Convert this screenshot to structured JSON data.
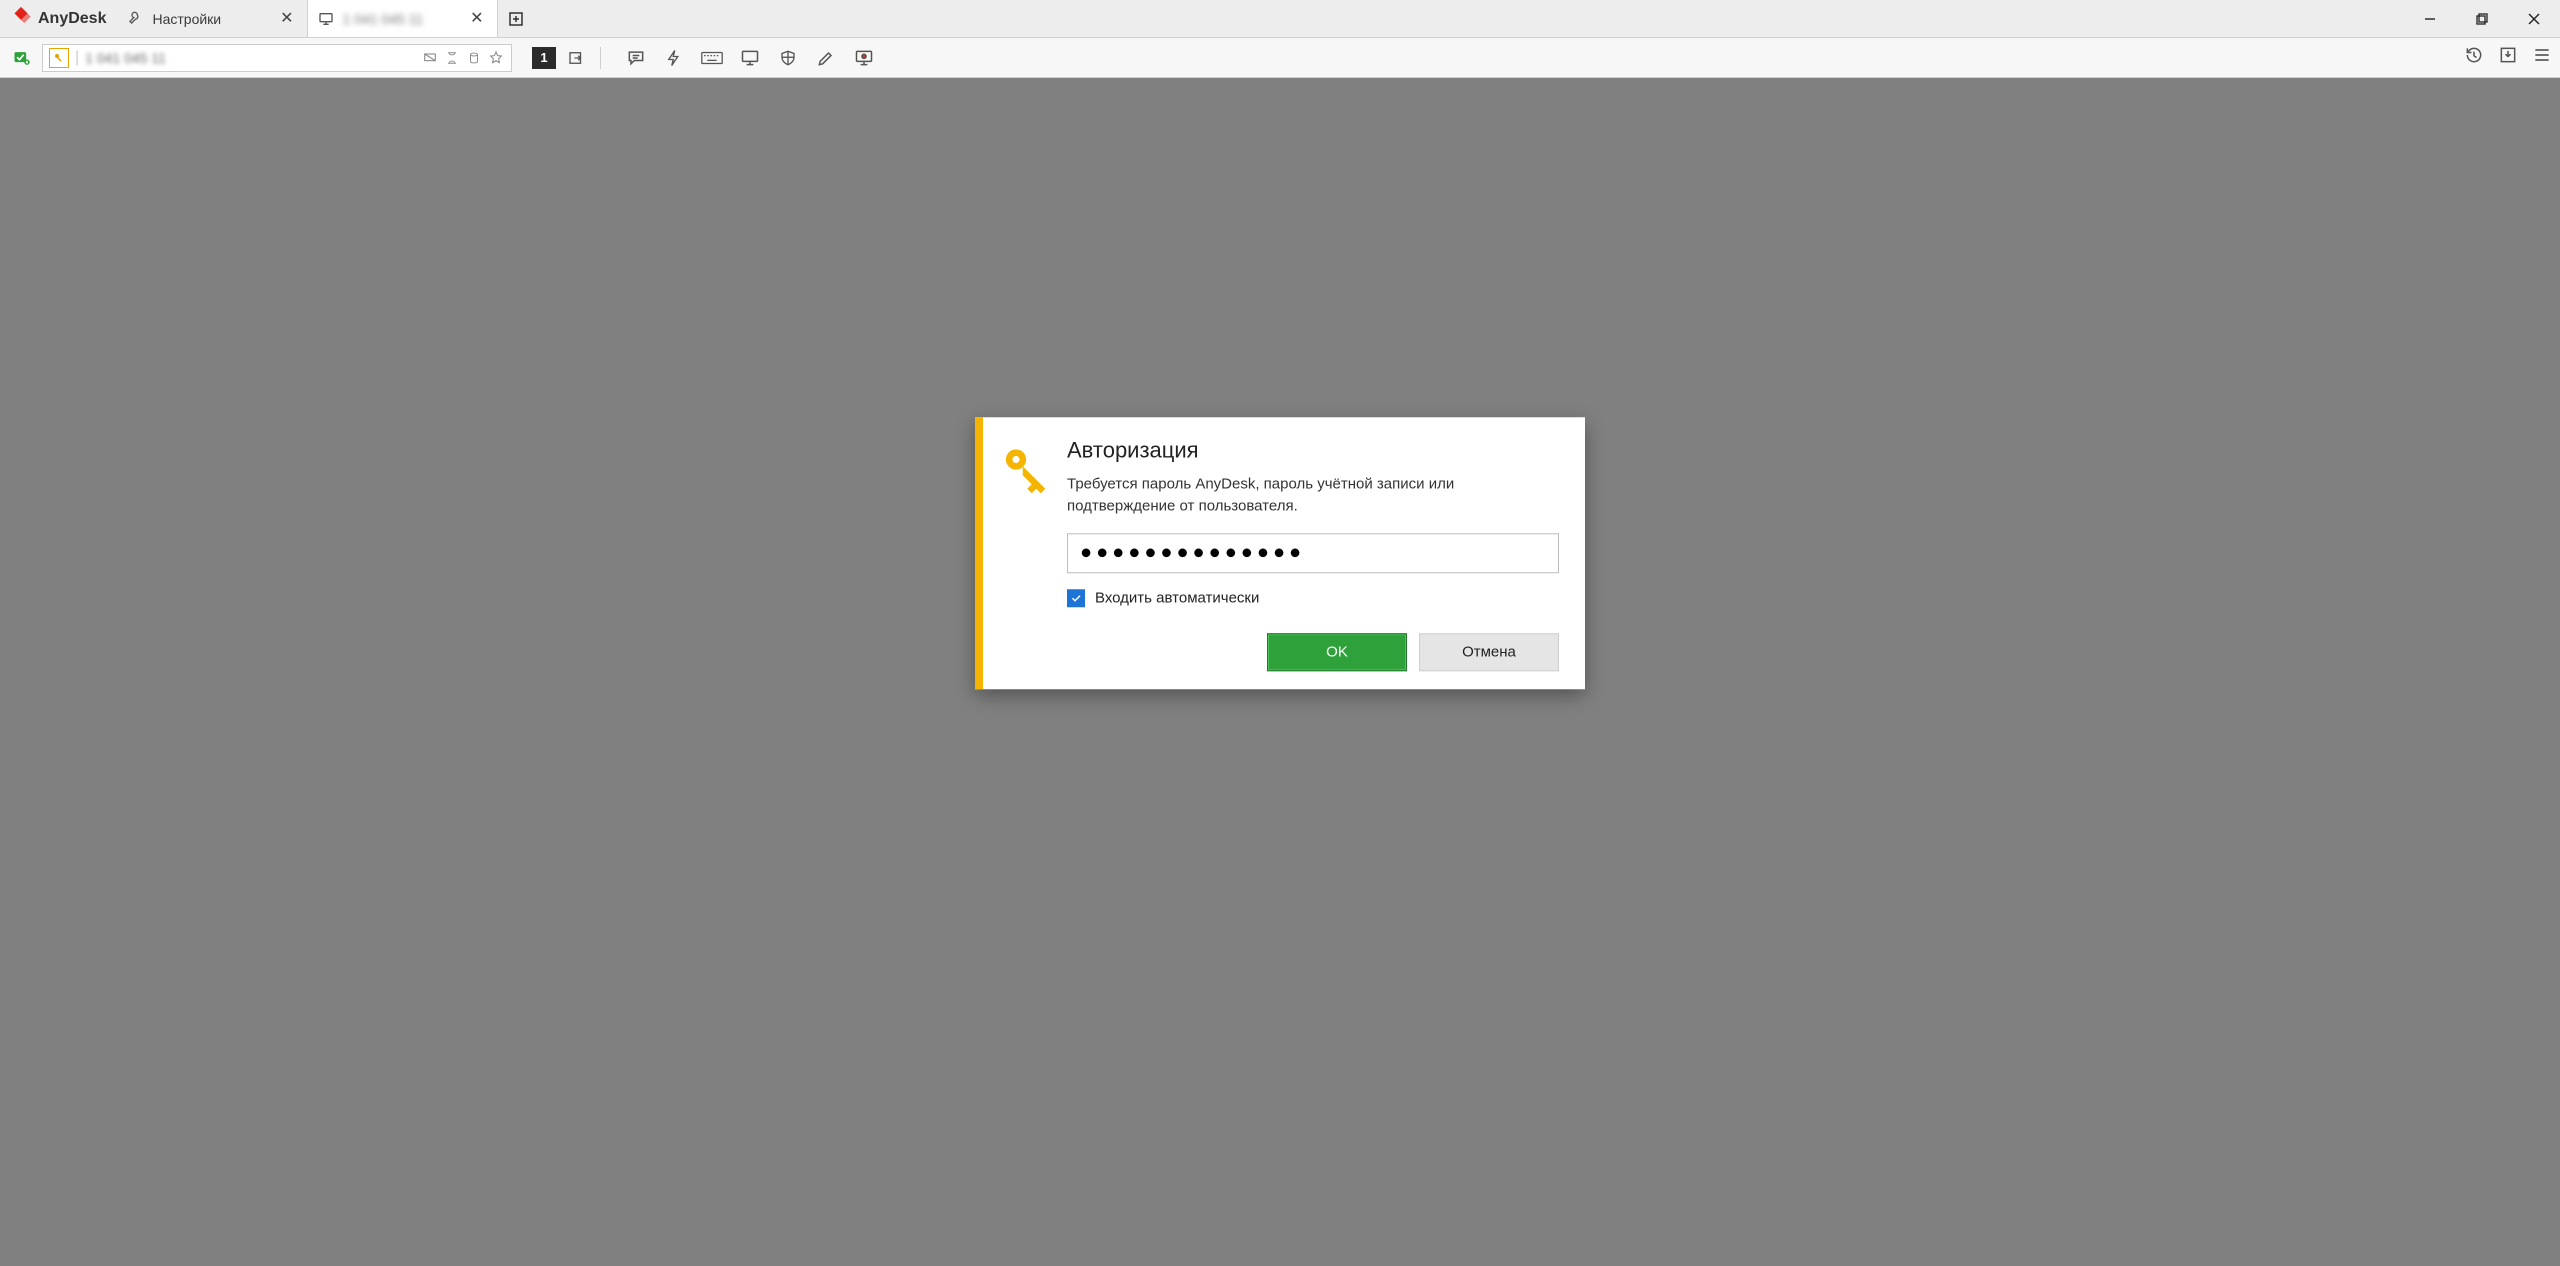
{
  "app": {
    "name": "AnyDesk"
  },
  "tabs": [
    {
      "label": "Настройки",
      "icon": "wrench",
      "active": false
    },
    {
      "label": "1 041 045 11",
      "icon": "monitor",
      "active": true,
      "redacted": true
    }
  ],
  "address_bar": {
    "value": "1 041 045 11"
  },
  "toolbar": {
    "monitor_badge": "1"
  },
  "dialog": {
    "title": "Авторизация",
    "text": "Требуется пароль AnyDesk, пароль учётной записи или подтверждение от пользователя.",
    "password_mask": "●●●●●●●●●●●●●●",
    "checkbox_label": "Входить автоматически",
    "checkbox_checked": true,
    "ok_label": "OK",
    "cancel_label": "Отмена"
  }
}
